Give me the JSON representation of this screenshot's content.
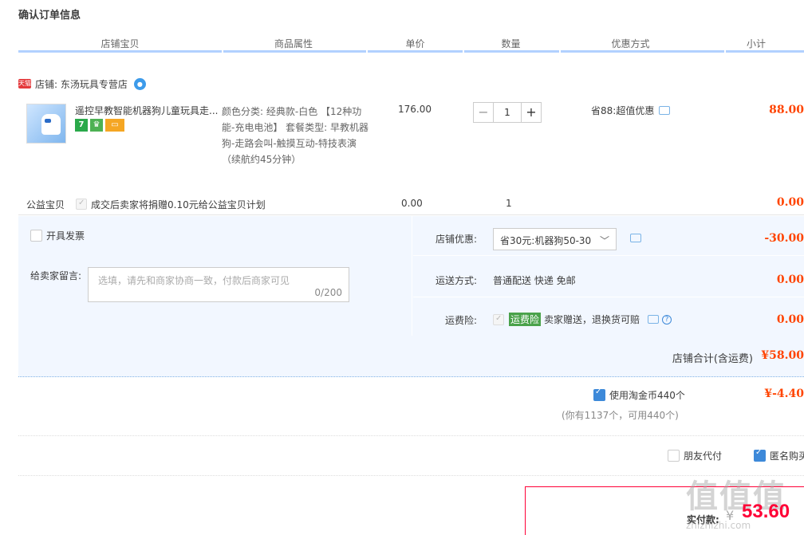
{
  "title": "确认订单信息",
  "headers": [
    "店铺宝贝",
    "商品属性",
    "单价",
    "数量",
    "优惠方式",
    "小计"
  ],
  "shop": {
    "badge": "天猫",
    "name": "店铺: 东汤玩具专营店"
  },
  "item": {
    "name": "遥控早教智能机器狗儿童玩具走...",
    "badges": [
      "7",
      "♛",
      "▭"
    ],
    "props": "颜色分类: 经典款-白色 【12种功能-充电电池】 套餐类型: 早教机器狗-走路会叫-触摸互动-特技表演（续航约45分钟）",
    "price": "176.00",
    "qty": "1",
    "promo": "省88:超值优惠",
    "subtotal": "88.00"
  },
  "charity": {
    "label": "公益宝贝",
    "text": "成交后卖家将捐赠0.10元给公益宝贝计划",
    "price": "0.00",
    "qty": "1",
    "subtotal": "0.00"
  },
  "invoice_label": "开具发票",
  "message": {
    "label": "给卖家留言:",
    "placeholder": "选填，请先和商家协商一致，付款后商家可见",
    "count": "0/200"
  },
  "shop_discount": {
    "label": "店铺优惠:",
    "value": "省30元:机器狗50-30",
    "amount": "-30.00"
  },
  "shipping": {
    "label": "运送方式:",
    "value": "普通配送 快递 免邮",
    "amount": "0.00"
  },
  "insurance": {
    "label": "运费险:",
    "badge": "运费险",
    "value": "卖家赠送，退换货可赔",
    "amount": "0.00"
  },
  "shop_total": {
    "label": "店铺合计(含运费)",
    "value": "¥58.00"
  },
  "coins": {
    "label": "使用淘金币440个",
    "sub": "(你有1137个，可用440个)",
    "amount": "¥-4.40"
  },
  "friend_pay": "朋友代付",
  "anonymous": "匿名购买",
  "pay": {
    "label": "实付款:",
    "yen": "¥",
    "value": "53.60"
  },
  "watermark": {
    "logo": "值值值",
    "url": "zhizhizhi.com"
  },
  "colors": {
    "accent": "#ff4400",
    "border_blue": "#b2d1ff",
    "panel": "#f2f7ff"
  }
}
